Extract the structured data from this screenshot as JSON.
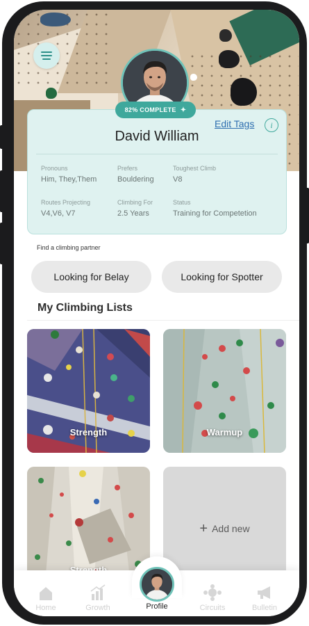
{
  "profile": {
    "completion": "82% COMPLETE",
    "name": "David William",
    "edit_tags": "Edit Tags",
    "info": "i",
    "fields": [
      {
        "label": "Pronouns",
        "value": "Him, They,Them"
      },
      {
        "label": "Prefers",
        "value": "Bouldering"
      },
      {
        "label": "Toughest Climb",
        "value": "V8"
      },
      {
        "label": "Routes Projecting",
        "value": "V4,V6, V7"
      },
      {
        "label": "Climbing For",
        "value": "2.5 Years"
      },
      {
        "label": "Status",
        "value": "Training for Competetion"
      }
    ]
  },
  "partner": {
    "label": "Find a climbing partner",
    "buttons": [
      "Looking for Belay",
      "Looking for Spotter"
    ]
  },
  "lists": {
    "title": "My Climbing Lists",
    "items": [
      "Strength",
      "Warmup",
      "Strength"
    ],
    "add_new": "Add new"
  },
  "tabs": [
    {
      "label": "Home",
      "icon": "home-icon"
    },
    {
      "label": "Growth",
      "icon": "growth-chart-icon"
    },
    {
      "label": "Profile",
      "icon": "avatar"
    },
    {
      "label": "Circuits",
      "icon": "circuits-icon"
    },
    {
      "label": "Bulletin",
      "icon": "megaphone-icon"
    }
  ],
  "colors": {
    "accent": "#3fa89c",
    "card_bg": "#dff2f0",
    "link": "#2f6fb0"
  }
}
